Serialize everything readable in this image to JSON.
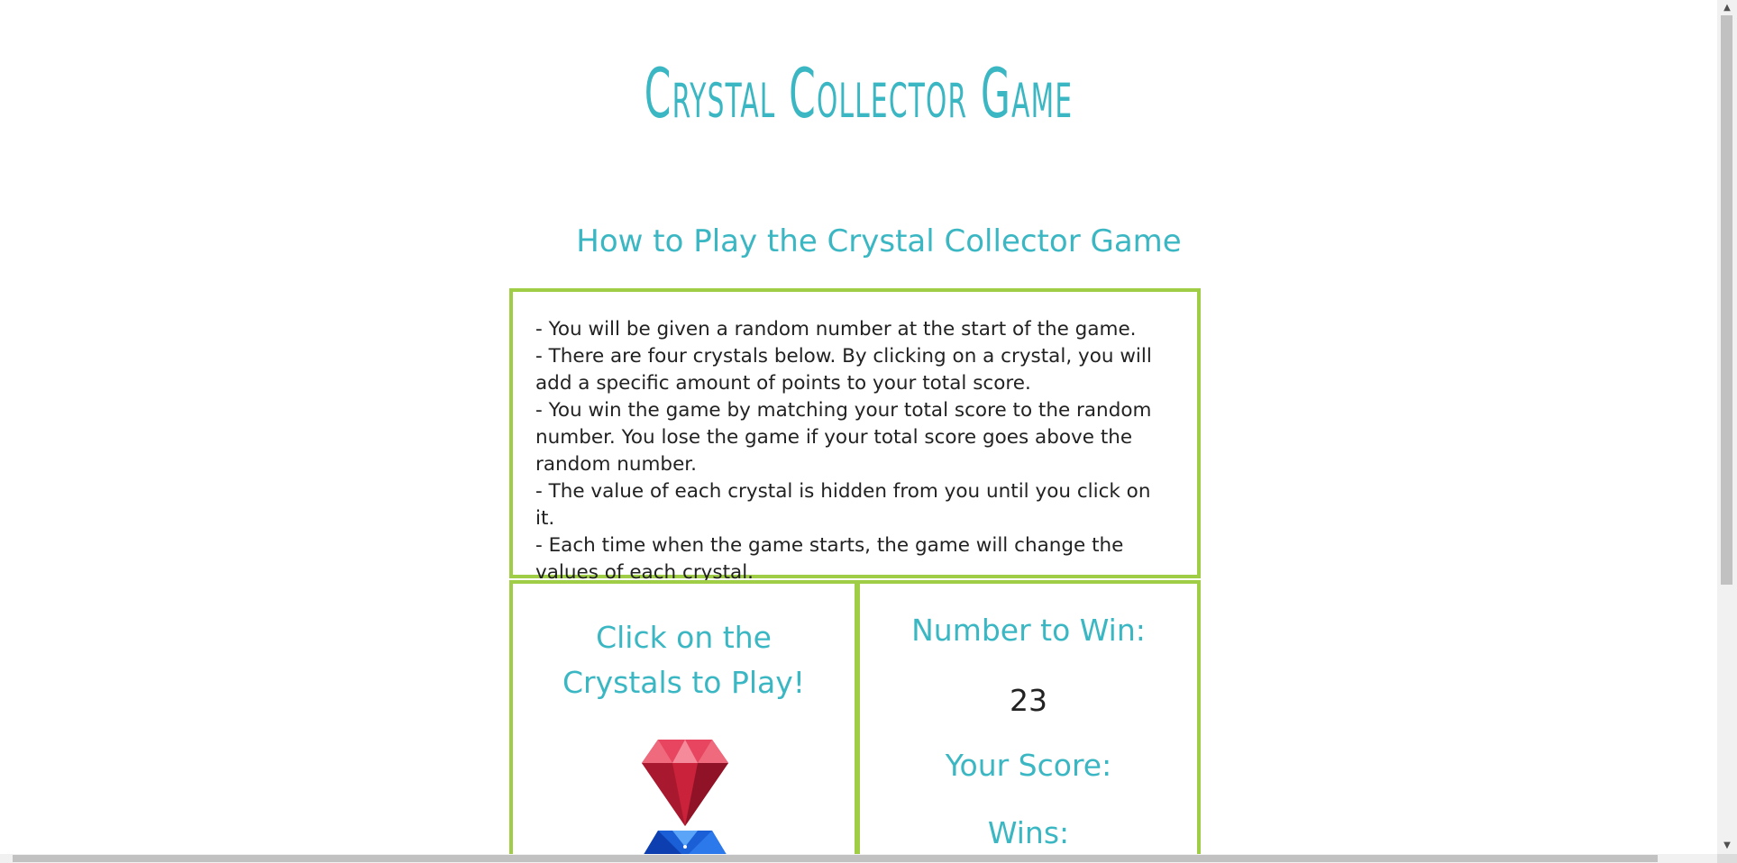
{
  "title": "Crystal Collector Game",
  "subtitle": "How to Play the Crystal Collector Game",
  "rules": [
    "- You will be given a random number at the start of the game.",
    "- There are four crystals below. By clicking on a crystal, you will add a specific amount of points to your total score.",
    "- You win the game by matching your total score to the random number. You lose the game if your total score goes above the random number.",
    "- The value of each crystal is hidden from you until you click on it.",
    "- Each time when the game starts, the game will change the values of each crystal."
  ],
  "play_panel": {
    "heading": "Click on the Crystals to Play!",
    "crystals": [
      {
        "name": "red-crystal",
        "color": "#d8283c"
      },
      {
        "name": "blue-crystal",
        "color": "#1a5fd6"
      }
    ]
  },
  "stats_panel": {
    "win_label": "Number to Win:",
    "target_number": "23",
    "score_label": "Your Score:",
    "wins_label": "Wins:"
  },
  "colors": {
    "accent": "#3ab7c3",
    "border": "#9fcd45",
    "text": "#222222"
  }
}
